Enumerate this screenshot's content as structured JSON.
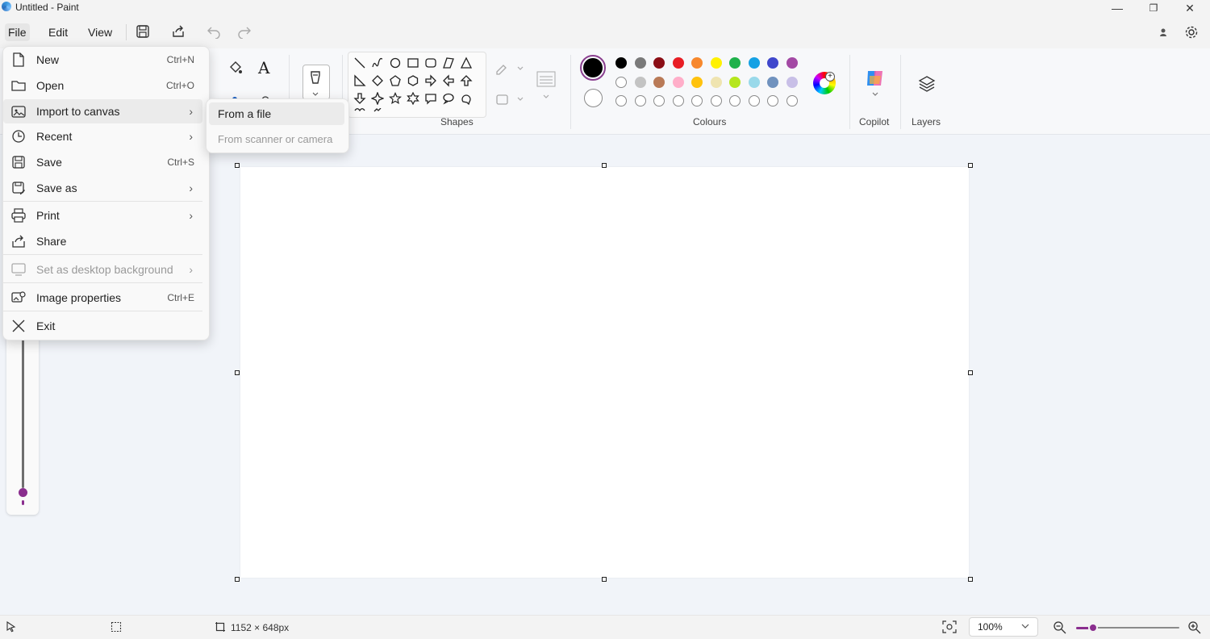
{
  "window": {
    "title": "Untitled - Paint",
    "buttons": {
      "minimize": "—",
      "maximize": "❐",
      "close": "✕"
    }
  },
  "menubar": {
    "file": "File",
    "edit": "Edit",
    "view": "View"
  },
  "ribbon": {
    "groups": {
      "shapes": "Shapes",
      "colours": "Colours",
      "copilot": "Copilot",
      "layers": "Layers"
    },
    "selected_colours": {
      "primary": "#000000",
      "secondary": "#ffffff"
    },
    "palette_row1": [
      "#000000",
      "#7a7a7a",
      "#8b0e16",
      "#e81e25",
      "#f7882d",
      "#fff100",
      "#1fb14b",
      "#15a1e4",
      "#3f47cc",
      "#a349a4"
    ],
    "palette_row2": [
      "#ffffff",
      "#c3c3c3",
      "#b97a57",
      "#ffaec9",
      "#ffc20e",
      "#efe4b0",
      "#b5e61d",
      "#99d9ea",
      "#7092be",
      "#c8bfe7"
    ]
  },
  "file_menu": {
    "items": [
      {
        "label": "New",
        "shortcut": "Ctrl+N",
        "icon": "new-file-icon"
      },
      {
        "label": "Open",
        "shortcut": "Ctrl+O",
        "icon": "open-folder-icon"
      },
      {
        "label": "Import to canvas",
        "icon": "import-image-icon"
      },
      {
        "label": "Recent",
        "icon": "clock-icon"
      },
      {
        "label": "Save",
        "shortcut": "Ctrl+S",
        "icon": "save-icon"
      },
      {
        "label": "Save as",
        "icon": "save-as-icon"
      },
      {
        "label": "Print",
        "icon": "printer-icon"
      },
      {
        "label": "Share",
        "icon": "share-icon"
      },
      {
        "label": "Set as desktop background",
        "icon": "desktop-icon"
      },
      {
        "label": "Image properties",
        "shortcut": "Ctrl+E",
        "icon": "image-properties-icon"
      },
      {
        "label": "Exit",
        "icon": "close-icon"
      }
    ]
  },
  "import_submenu": {
    "from_file": "From a file",
    "from_scanner": "From scanner or camera"
  },
  "statusbar": {
    "canvas_size": "1152 × 648px",
    "zoom": "100%"
  }
}
